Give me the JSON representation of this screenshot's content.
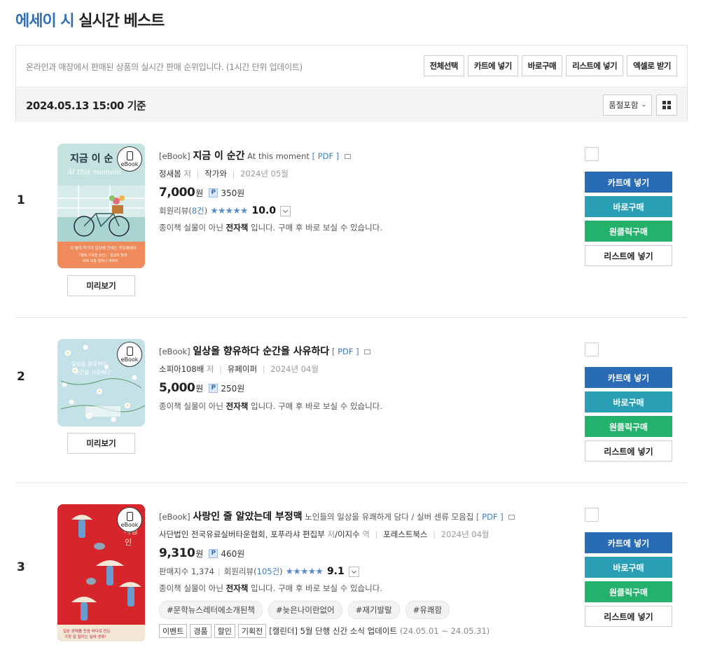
{
  "header": {
    "category": "에세이 시",
    "title": "실시간 베스트"
  },
  "toolbar": {
    "description": "온라인과 매장에서 판매된 상품의 실시간 판매 순위입니다. (1시간 단위 업데이트)",
    "buttons": [
      "전체선택",
      "카트에 넣기",
      "바로구매",
      "리스트에 넣기",
      "엑셀로 받기"
    ],
    "date": "2024.05.13 15:00 기준",
    "filter": "품절포함"
  },
  "labels": {
    "preview": "미리보기",
    "cart": "카트에 넣기",
    "buy": "바로구매",
    "oneclick": "원클릭구매",
    "list": "리스트에 넣기",
    "ebook": "eBook",
    "won": "원",
    "point": "P",
    "author_suffix": "저",
    "review_prefix": "회원리뷰",
    "note_a": "종이책 실물이 아닌 ",
    "note_b": "전자책",
    "note_c": " 입니다. 구매 후 바로 보실 수 있습니다."
  },
  "items": [
    {
      "rank": "1",
      "format": "[eBook]",
      "title": "지금 이 순간",
      "subtitle": "At this moment",
      "pdf": "[ PDF ]",
      "author": "정새봄",
      "publisher": "작가와",
      "date": "2024년 05월",
      "price": "7,000",
      "points": "350원",
      "review_count": "8건",
      "rating": "10.0",
      "cover_title": "지금 이 순",
      "cover_sub": "At this moment"
    },
    {
      "rank": "2",
      "format": "[eBook]",
      "title": "일상을 향유하다 순간을 사유하다",
      "pdf": "[ PDF ]",
      "author": "소피아108배",
      "publisher": "유페이퍼",
      "date": "2024년 04월",
      "price": "5,000",
      "points": "250원"
    },
    {
      "rank": "3",
      "format": "[eBook]",
      "title": "사랑인 줄 알았는데 부정맥",
      "subtitle": "노인들의 일상을 유쾌하게 담다 / 실버 센류 모음집",
      "pdf": "[ PDF ]",
      "author": "사단법인 전국유료실버타운협회, 포푸라샤 편집부",
      "translator": "이지수",
      "translator_suffix": "역",
      "publisher": "포레스트북스",
      "date": "2024년 04월",
      "price": "9,310",
      "points": "460원",
      "sales_label": "판매지수",
      "sales": "1,374",
      "review_count": "105건",
      "rating": "9.1",
      "tags": [
        "#문학뉴스레터에소개된책",
        "#늦은나이란없어",
        "#재기발랄",
        "#유쾌함"
      ],
      "event_tags": [
        "이벤트",
        "경품",
        "할인",
        "기획전"
      ],
      "event_text": "[캘린더] 5월 단행 신간 소식 업데이트",
      "event_period": "(24.05.01 ~ 24.05.31)"
    }
  ]
}
